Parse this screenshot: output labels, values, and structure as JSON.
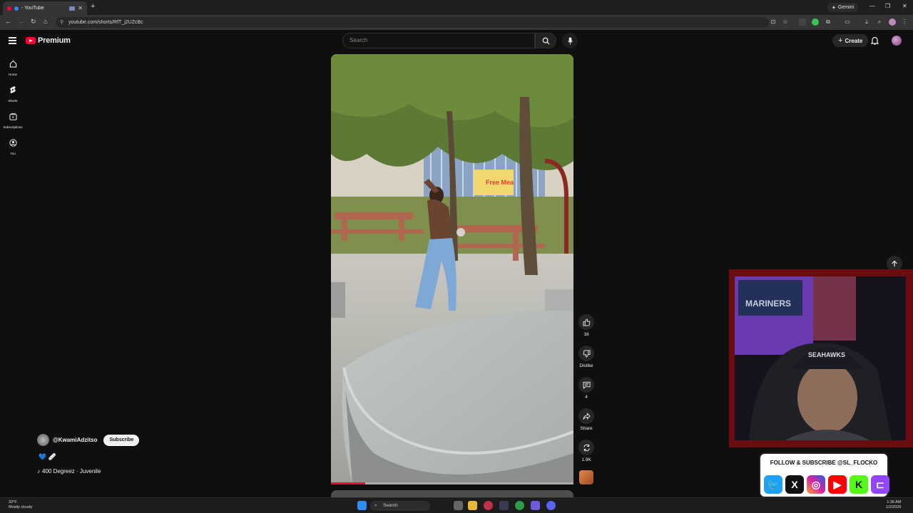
{
  "browser": {
    "tab_title": "- YouTube",
    "url": "youtube.com/shorts/RfT_j2UZcBc",
    "gemini_label": "Gemini"
  },
  "header": {
    "logo_text": "Premium",
    "search_placeholder": "Search",
    "create_label": "Create"
  },
  "sidebar": {
    "items": [
      {
        "label": "Home",
        "icon": "home-icon"
      },
      {
        "label": "Shorts",
        "icon": "shorts-icon"
      },
      {
        "label": "Subscriptions",
        "icon": "subscriptions-icon"
      },
      {
        "label": "You",
        "icon": "you-icon"
      }
    ]
  },
  "video": {
    "progress": 0.14,
    "sign_text": "Free Mea"
  },
  "actions": {
    "like_count": "16",
    "dislike_label": "Dislike",
    "comment_count": "4",
    "share_label": "Share",
    "remix_count": "1.9K"
  },
  "channel": {
    "handle": "@KwamiAdzitso",
    "subscribe_label": "Subscribe",
    "description": "💙 🩹",
    "song": "400 Degreez · Juvenile"
  },
  "overlay": {
    "follow_text": "FOLLOW & SUBSCRIBE @SL_FLOCKO",
    "cap_text": "SEAHAWKS",
    "banner_text": "MARINERS"
  },
  "taskbar": {
    "temp": "33°F",
    "weather": "Mostly cloudy",
    "search_label": "Search",
    "time": "1:36 AM",
    "date": "1/2/2026"
  },
  "colors": {
    "accent": "#ff0033",
    "background": "#0f0f0f",
    "cam_border": "#6b0d10"
  }
}
